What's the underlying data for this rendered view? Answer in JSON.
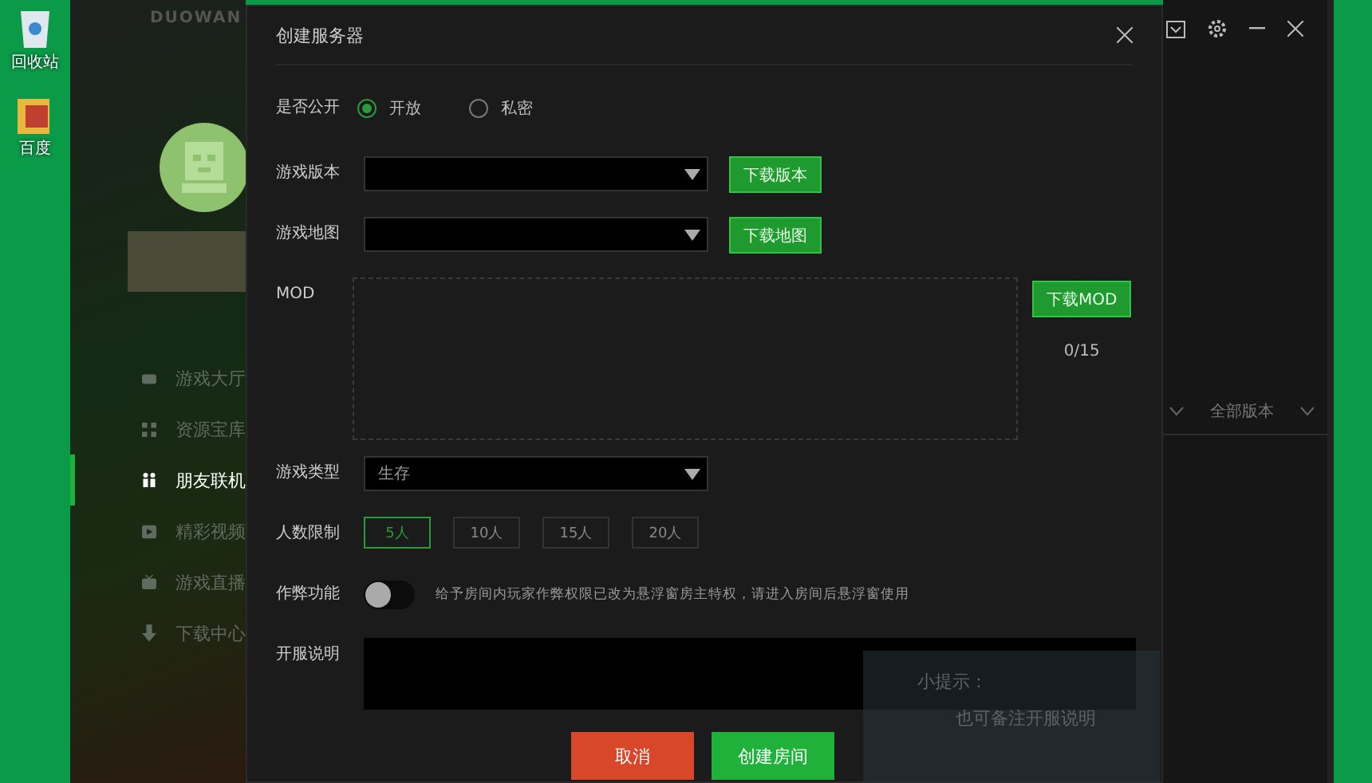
{
  "desktop": {
    "icons": [
      {
        "kind": "bin",
        "label": "回收站"
      },
      {
        "kind": "folder",
        "label": "百度"
      }
    ]
  },
  "app": {
    "logo": "DUOWAN",
    "nav": [
      {
        "kind": "gamepad",
        "label": "游戏大厅",
        "selected": false
      },
      {
        "kind": "grid",
        "label": "资源宝库",
        "selected": false
      },
      {
        "kind": "people",
        "label": "朋友联机",
        "selected": true
      },
      {
        "kind": "play",
        "label": "精彩视频",
        "selected": false
      },
      {
        "kind": "tv",
        "label": "游戏直播",
        "selected": false
      },
      {
        "kind": "download",
        "label": "下载中心",
        "selected": false
      }
    ],
    "filter": {
      "value": "全部版本"
    }
  },
  "dialog": {
    "title": "创建服务器",
    "fields": [
      {
        "kind": "radio",
        "label": "是否公开",
        "options": [
          {
            "label": "开放",
            "selected": true
          },
          {
            "label": "私密",
            "selected": false
          }
        ]
      },
      {
        "kind": "select",
        "label": "游戏版本",
        "button": "下载版本"
      },
      {
        "kind": "select",
        "label": "游戏地图",
        "button": "下载地图"
      },
      {
        "kind": "mod",
        "label": "MOD",
        "button": "下载MOD",
        "count": "0/15"
      },
      {
        "kind": "select",
        "label": "游戏类型",
        "value": "生存"
      },
      {
        "kind": "options",
        "label": "人数限制",
        "options": [
          {
            "label": "5人",
            "selected": true
          },
          {
            "label": "10人",
            "selected": false
          },
          {
            "label": "15人",
            "selected": false
          },
          {
            "label": "20人",
            "selected": false
          }
        ]
      },
      {
        "kind": "toggle",
        "label": "作弊功能",
        "on": false,
        "hint": "给予房间内玩家作弊权限已改为悬浮窗房主特权，请进入房间后悬浮窗使用"
      },
      {
        "kind": "textarea",
        "label": "开服说明"
      }
    ],
    "tip": {
      "title": "小提示：",
      "text": "也可备注开服说明"
    },
    "buttons": [
      {
        "kind": "cancel",
        "label": "取消"
      },
      {
        "kind": "primary",
        "label": "创建房间"
      }
    ]
  }
}
